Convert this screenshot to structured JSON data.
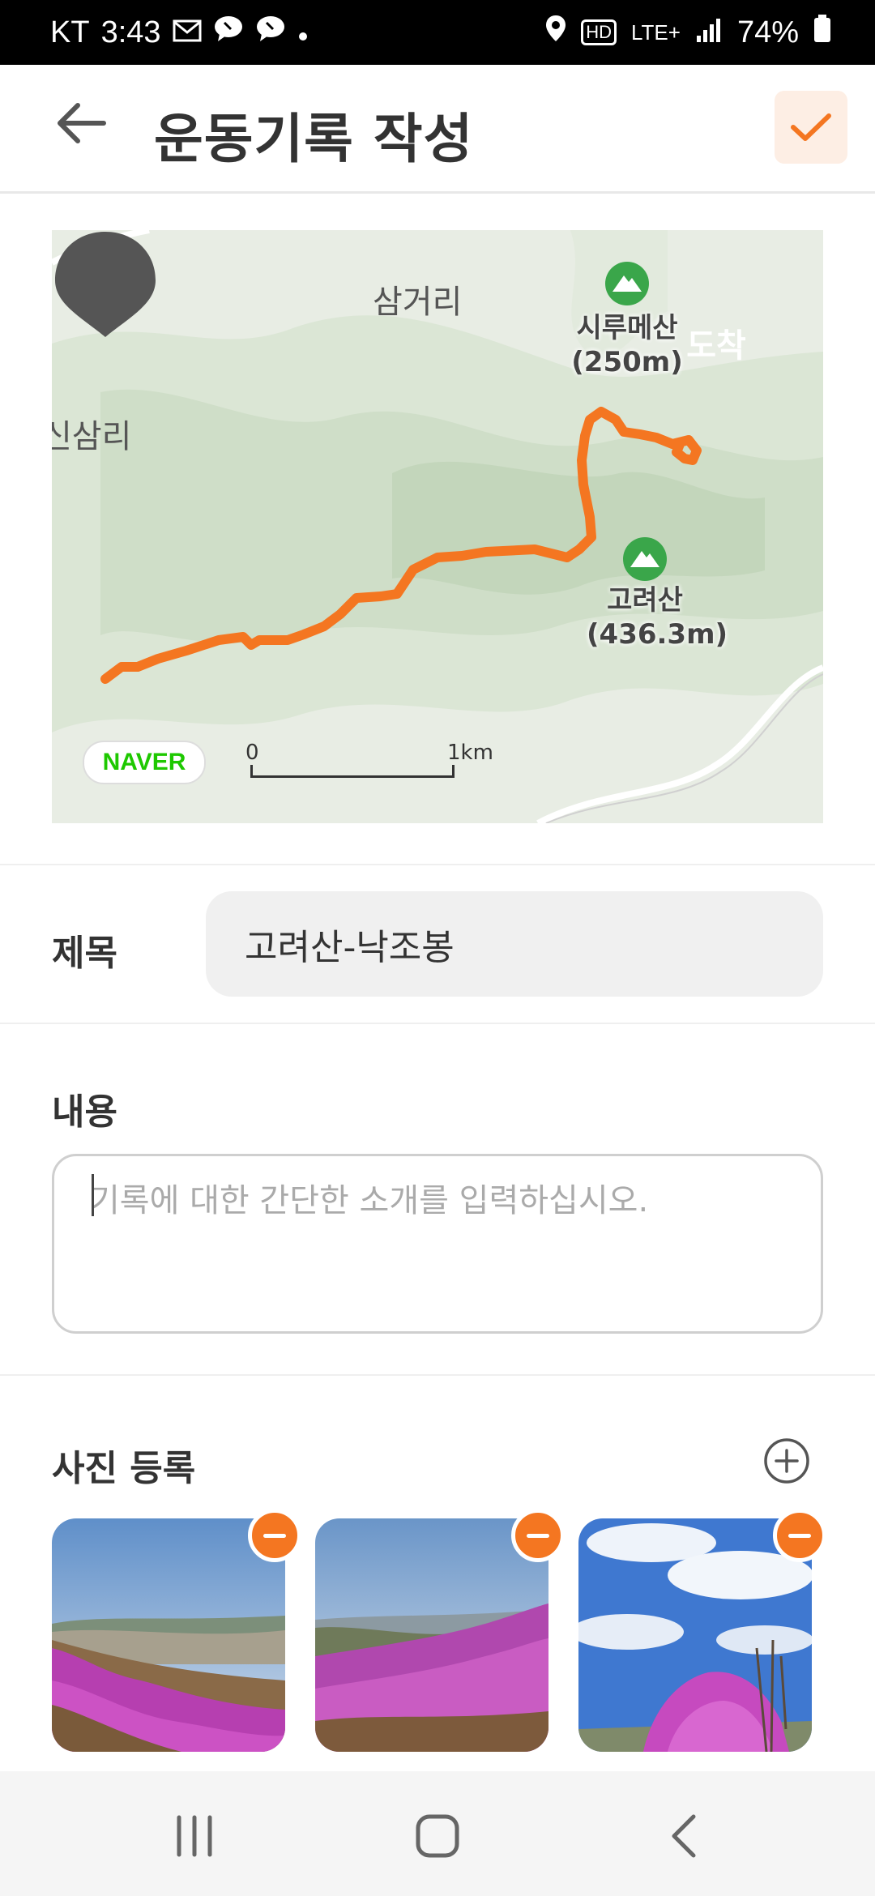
{
  "status_bar": {
    "carrier": "KT",
    "time": "3:43",
    "network": "LTE+",
    "battery": "74%",
    "hd_badge": "HD"
  },
  "header": {
    "title": "운동기록 작성",
    "accent_color": "#f47621"
  },
  "map": {
    "place_labels": [
      "삼거리",
      "신삼리"
    ],
    "peaks": [
      {
        "name": "시루메산",
        "elevation": "(250m)"
      },
      {
        "name": "고려산",
        "elevation": "(436.3m)"
      }
    ],
    "arrival_label": "도착",
    "scale_start": "0",
    "scale_end": "1km",
    "provider_logo": "NAVER"
  },
  "form": {
    "title_label": "제목",
    "title_value": "고려산-낙조봉",
    "content_label": "내용",
    "content_placeholder": "기록에 대한 간단한 소개를 입력하십시오.",
    "content_value": "",
    "photo_label": "사진 등록"
  },
  "photos": [
    {
      "alt": "azalea-hill-1"
    },
    {
      "alt": "azalea-hill-2"
    },
    {
      "alt": "azalea-sky-3"
    }
  ]
}
